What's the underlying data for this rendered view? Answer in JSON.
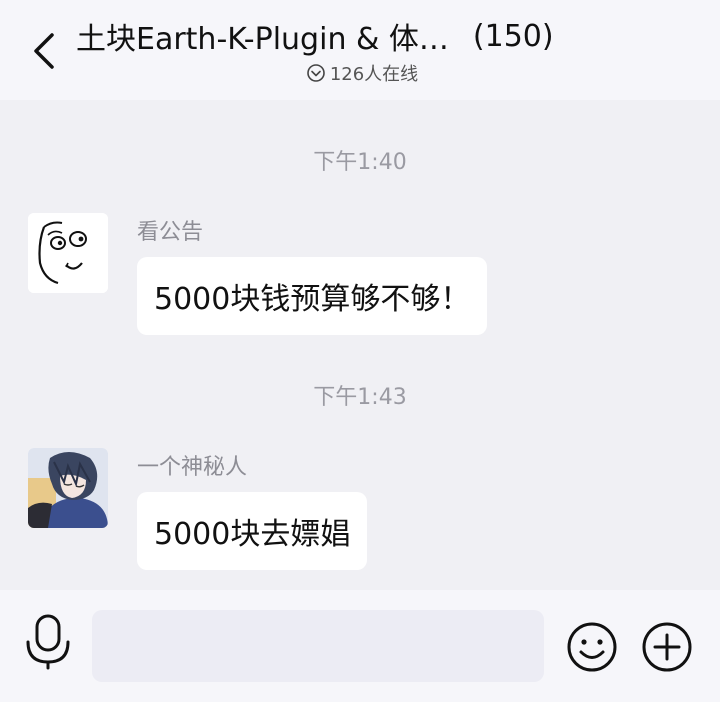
{
  "header": {
    "title": "土块Earth-K-Plugin & 体…",
    "member_count": "(150)",
    "online_status": "126人在线"
  },
  "messages": [
    {
      "timestamp": "下午1:40",
      "sender": "看公告",
      "text": "5000块钱预算够不够！",
      "avatar_icon": "rage-face-avatar-icon"
    },
    {
      "timestamp": "下午1:43",
      "sender": "一个神秘人",
      "text": "5000块去嫖娼",
      "avatar_icon": "anime-boy-avatar-icon"
    }
  ],
  "input_bar": {
    "value": "",
    "placeholder": ""
  },
  "icons": {
    "back": "chevron-left-icon",
    "online": "chevron-down-circle-icon",
    "voice": "microphone-icon",
    "emoji": "smiley-icon",
    "more": "plus-circle-icon"
  },
  "colors": {
    "page_background": "#f0f0f4",
    "header_background": "#f6f6fa",
    "bubble_background": "#ffffff",
    "timestamp_text": "#9a9aa2"
  }
}
